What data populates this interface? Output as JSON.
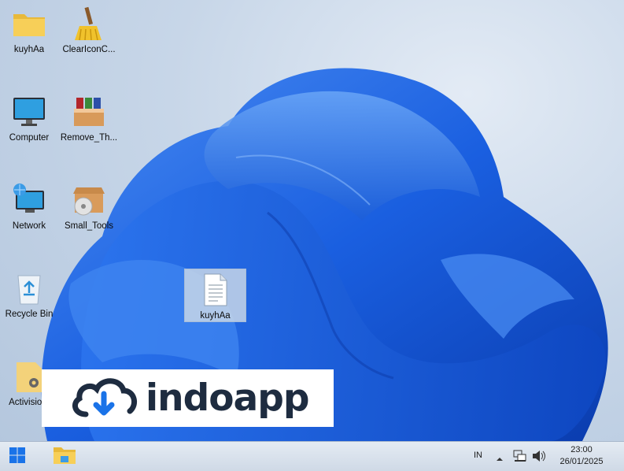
{
  "desktop": {
    "icons": [
      {
        "label": "kuyhAa",
        "icon": "folder-icon"
      },
      {
        "label": "ClearIconC...",
        "icon": "broom-icon"
      },
      {
        "label": "Computer",
        "icon": "computer-icon"
      },
      {
        "label": "Remove_Th...",
        "icon": "winrar-archive-icon"
      },
      {
        "label": "Network",
        "icon": "network-icon"
      },
      {
        "label": "Small_Tools",
        "icon": "package-disc-icon"
      },
      {
        "label": "Recycle Bin",
        "icon": "recycle-bin-icon"
      },
      {
        "label": "Activisio...",
        "icon": "folder-gear-icon"
      },
      {
        "label": "kuyhAa",
        "icon": "text-document-icon",
        "selected": true
      }
    ]
  },
  "watermark": {
    "text": "indoapp",
    "icon": "cloud-download-icon"
  },
  "taskbar": {
    "start_icon": "windows-start-icon",
    "pinned": [
      {
        "name": "File Explorer",
        "icon": "file-explorer-icon"
      }
    ],
    "tray": {
      "language": "IN",
      "icons": [
        "show-hidden-icons-chevron-icon",
        "network-status-icon",
        "volume-icon"
      ],
      "time": "23:00",
      "date": "26/01/2025"
    }
  },
  "colors": {
    "wallpaper_bloom": "#1f63e0",
    "taskbar": "#dbe4ee",
    "accent": "#1a73e8"
  }
}
